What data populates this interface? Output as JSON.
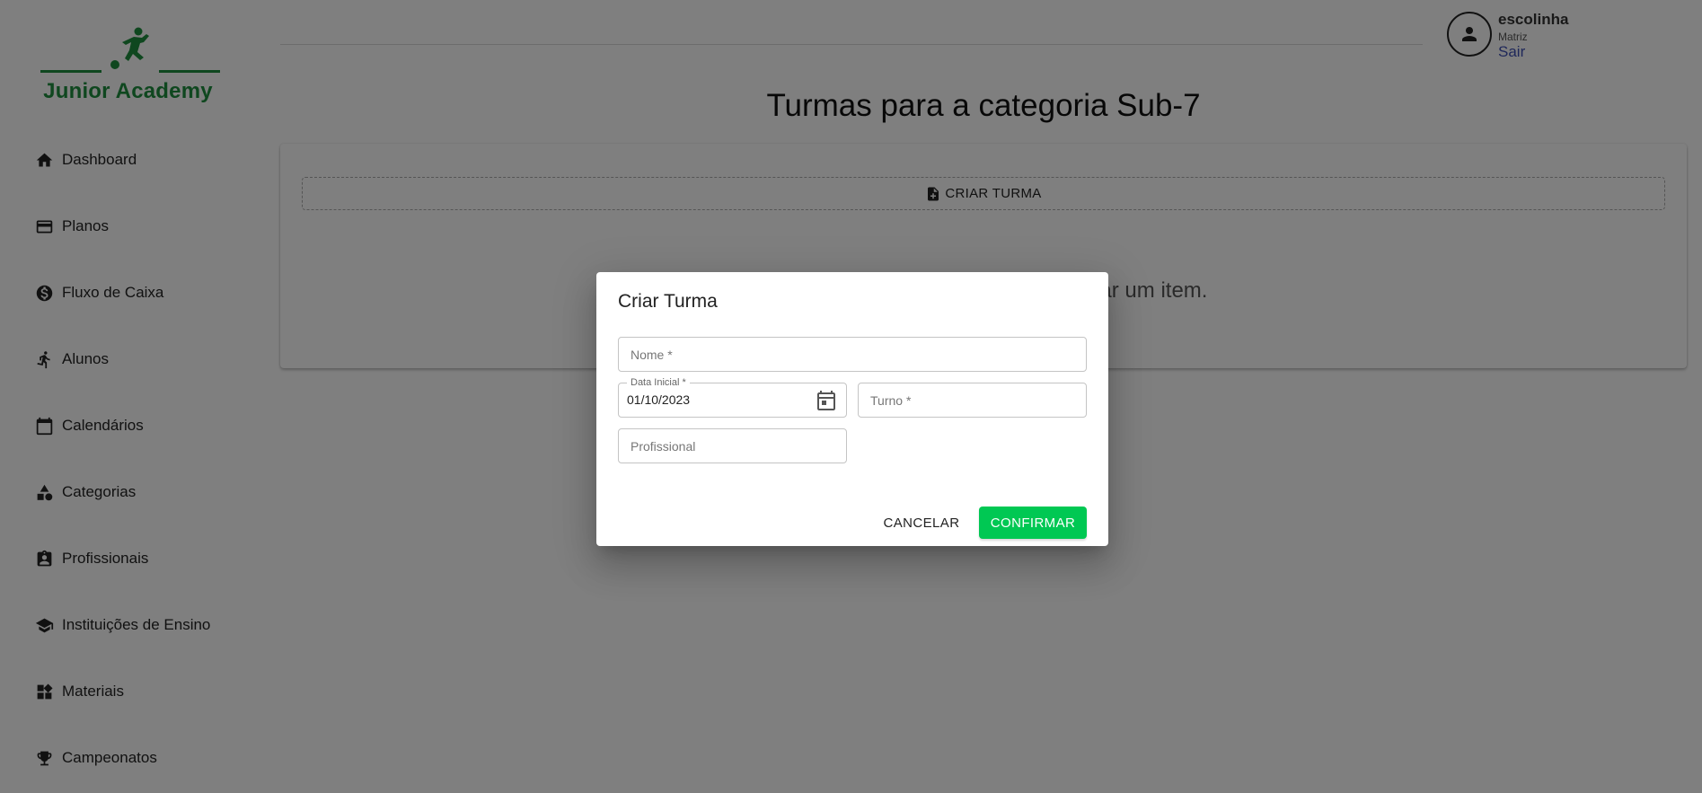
{
  "brand": {
    "name": "Junior Academy",
    "color": "#1f8f3e"
  },
  "sidebar": {
    "items": [
      {
        "label": "Dashboard",
        "icon": "home-icon"
      },
      {
        "label": "Planos",
        "icon": "credit-card-icon"
      },
      {
        "label": "Fluxo de Caixa",
        "icon": "dollar-circle-icon"
      },
      {
        "label": "Alunos",
        "icon": "running-person-icon"
      },
      {
        "label": "Calendários",
        "icon": "calendar-icon"
      },
      {
        "label": "Categorias",
        "icon": "category-shapes-icon"
      },
      {
        "label": "Profissionais",
        "icon": "badge-icon"
      },
      {
        "label": "Instituições de Ensino",
        "icon": "school-icon"
      },
      {
        "label": "Materiais",
        "icon": "widgets-icon"
      },
      {
        "label": "Campeonatos",
        "icon": "trophy-icon"
      }
    ]
  },
  "user": {
    "name": "escolinha",
    "unit": "Matriz",
    "logout_label": "Sair",
    "logout_color": "#3f51b5"
  },
  "main": {
    "title": "Turmas para a categoria Sub-7",
    "create_label": "CRIAR TURMA",
    "empty_message": "Clique no botão acima para cadastrar um item."
  },
  "dialog": {
    "title": "Criar Turma",
    "fields": {
      "nome": {
        "placeholder": "Nome *"
      },
      "data_inicial": {
        "label": "Data Inicial *",
        "value": "01/10/2023"
      },
      "turno": {
        "placeholder": "Turno *"
      },
      "profissional": {
        "placeholder": "Profissional"
      }
    },
    "cancel_label": "CANCELAR",
    "confirm_label": "CONFIRMAR",
    "confirm_color": "#00c853"
  }
}
